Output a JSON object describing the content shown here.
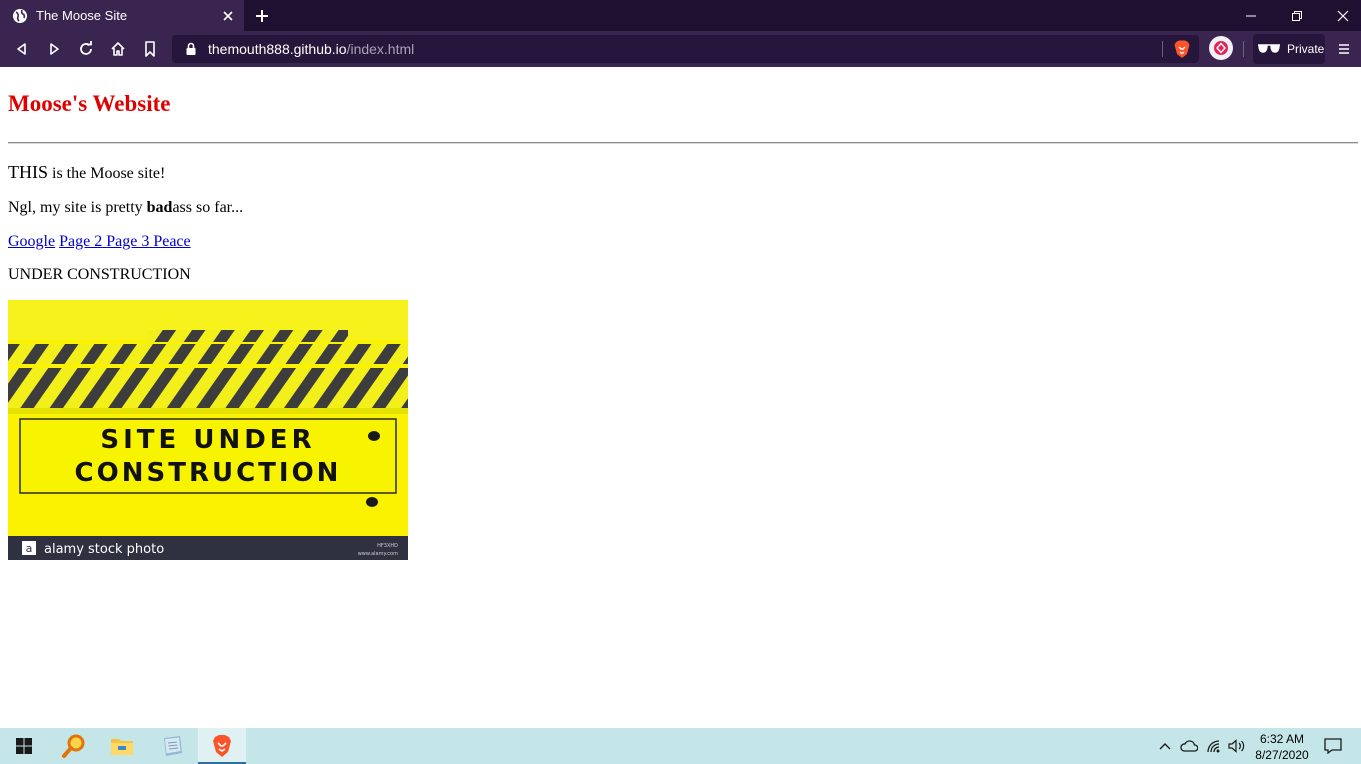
{
  "browser": {
    "tab": {
      "title": "The Moose Site",
      "icon": "globe-icon"
    },
    "url": {
      "host": "themouth888.github.io",
      "path": "/index.html"
    },
    "private_label": "Private",
    "colors": {
      "tabbar": "#1f1032",
      "toolbar": "#3a2551",
      "urlbar": "#26163b"
    }
  },
  "page": {
    "heading": "Moose's Website",
    "heading_color": "#e00000",
    "intro": {
      "big": "THIS",
      "rest": " is the Moose site!"
    },
    "line2": {
      "before": "Ngl, my site is pretty ",
      "bold": "bad",
      "after": "ass so far..."
    },
    "links": [
      "Google",
      "Page 2",
      "Page 3",
      "Peace"
    ],
    "construction": "UNDER CONSTRUCTION",
    "image": {
      "sign_line1": "SITE UNDER",
      "sign_line2": "CONSTRUCTION",
      "watermark": "alamy stock photo",
      "watermark_small_1": "HF3XHD",
      "watermark_small_2": "www.alamy.com"
    }
  },
  "taskbar": {
    "time": "6:32 AM",
    "date": "8/27/2020",
    "apps": [
      "windows-start-icon",
      "search-icon",
      "file-explorer-icon",
      "notes-app-icon",
      "brave-browser-icon"
    ]
  }
}
